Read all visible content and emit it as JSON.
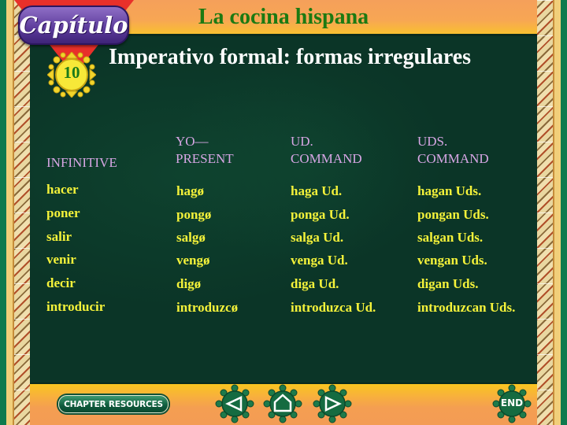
{
  "header": {
    "logo_text": "Capítulo",
    "title": "La cocina hispana",
    "chapter_number": "10",
    "subtitle": "Imperativo formal: formas irregulares"
  },
  "table": {
    "headers": [
      {
        "line1": "",
        "line2": "INFINITIVE"
      },
      {
        "line1": "YO—",
        "line2": "PRESENT"
      },
      {
        "line1": "UD.",
        "line2": "COMMAND"
      },
      {
        "line1": "UDS.",
        "line2": "COMMAND"
      }
    ],
    "rows": [
      [
        "hacer",
        "hagø",
        "haga Ud.",
        "hagan Uds."
      ],
      [
        "poner",
        "pongø",
        "ponga Ud.",
        "pongan Uds."
      ],
      [
        "salir",
        "salgø",
        "salga Ud.",
        "salgan Uds."
      ],
      [
        "venir",
        "vengø",
        "venga Ud.",
        "vengan Uds."
      ],
      [
        "decir",
        "digø",
        "diga Ud.",
        "digan Uds."
      ],
      [
        "introducir",
        "introduzcø",
        "introduzca Ud.",
        "introduzcan Uds."
      ]
    ]
  },
  "footer": {
    "chapter_resources_label": "CHAPTER RESOURCES",
    "prev_icon": "left-arrow-icon",
    "home_icon": "home-icon",
    "next_icon": "right-arrow-icon",
    "end_label": "END"
  },
  "colors": {
    "header_band": "#f7a654",
    "title_green": "#1c7a12",
    "background": "#0b3527",
    "cell_yellow": "#f4f23a",
    "header_lilac": "#d7a6e4",
    "triangle_red": "#e8302a",
    "logo_purple": "#5b3a9a"
  }
}
